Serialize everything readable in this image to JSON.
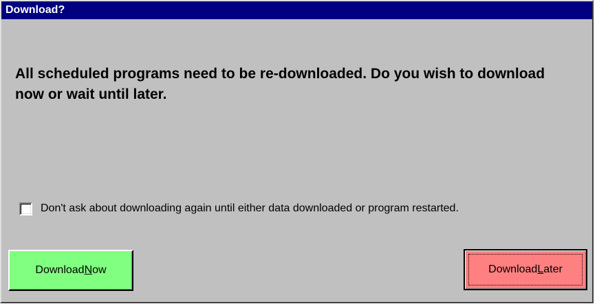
{
  "window": {
    "title": "Download?"
  },
  "message": "All scheduled programs need to be re-downloaded. Do you wish to download now or wait until later.",
  "checkbox": {
    "label": "Don't ask about downloading again until either data downloaded or program restarted.",
    "checked": false
  },
  "buttons": {
    "download_now": {
      "prefix": "Download ",
      "accel": "N",
      "suffix": "ow",
      "color": "#80ff80"
    },
    "download_later": {
      "prefix": "Download ",
      "accel": "L",
      "suffix": "ater",
      "color": "#ff8080"
    }
  },
  "colors": {
    "titlebar": "#000080",
    "dialog_face": "#c0c0c0"
  }
}
